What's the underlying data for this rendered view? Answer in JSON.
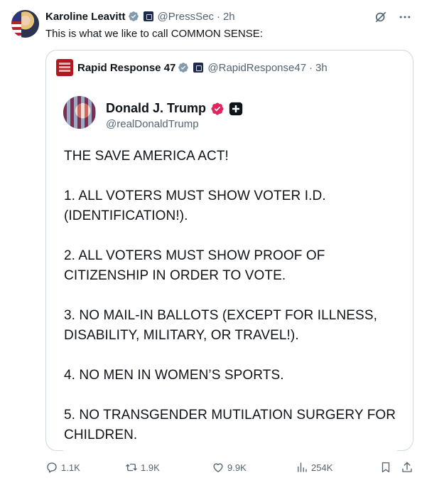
{
  "tweet": {
    "author_name": "Karoline Leavitt",
    "handle": "@PressSec",
    "separator": "·",
    "time": "2h",
    "text": "This is what we like to call COMMON SENSE:"
  },
  "quote": {
    "author_name": "Rapid Response 47",
    "handle": "@RapidResponse47",
    "separator": "·",
    "time": "3h",
    "embedded_post": {
      "author_name": "Donald J. Trump",
      "handle": "@realDonaldTrump",
      "lines": [
        "THE SAVE AMERICA ACT!",
        "",
        "1. ALL VOTERS MUST SHOW VOTER I.D.",
        "(IDENTIFICATION!).",
        "",
        "2. ALL VOTERS MUST SHOW PROOF OF",
        "CITIZENSHIP IN ORDER TO VOTE.",
        "",
        "3. NO MAIL-IN BALLOTS (EXCEPT FOR ILLNESS,",
        "DISABILITY, MILITARY, OR TRAVEL!).",
        "",
        "4. NO MEN IN WOMEN’S SPORTS.",
        "",
        "5. NO TRANSGENDER MUTILATION SURGERY FOR",
        "CHILDREN."
      ]
    }
  },
  "actions": {
    "replies": "1.1K",
    "reposts": "1.9K",
    "likes": "9.9K",
    "views": "254K"
  },
  "icons": {
    "verified": "verified-badge-icon",
    "government": "government-label-icon",
    "grok": "grok-icon",
    "more": "more-options-icon",
    "reply": "reply-icon",
    "repost": "repost-icon",
    "like": "heart-icon",
    "views": "views-icon",
    "bookmark": "bookmark-icon",
    "share": "share-icon"
  },
  "colors": {
    "verified_gray": "#829aab",
    "verified_pink": "#e0245e",
    "secondary_text": "#536471",
    "border": "#cfd9de"
  }
}
